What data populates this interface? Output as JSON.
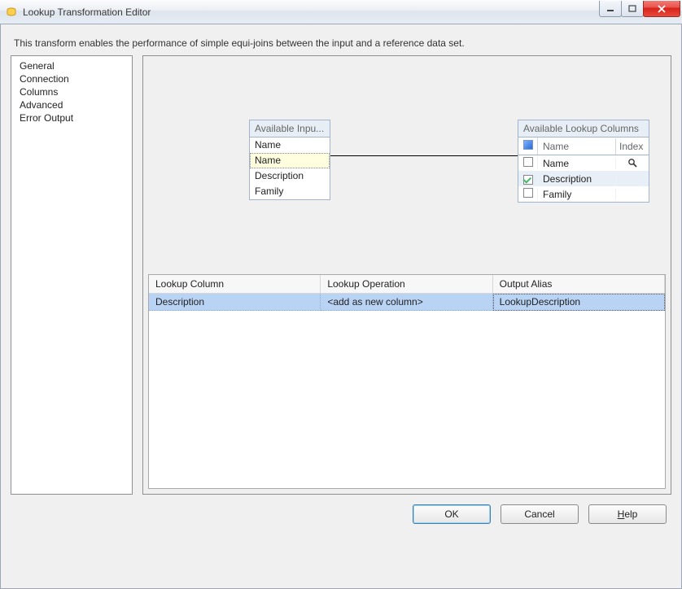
{
  "window": {
    "title": "Lookup Transformation Editor"
  },
  "description": "This transform enables the performance of simple equi-joins between the input and a reference data set.",
  "nav": {
    "items": [
      "General",
      "Connection",
      "Columns",
      "Advanced",
      "Error Output"
    ],
    "selected": "Columns"
  },
  "inputColumns": {
    "title": "Available Inpu...",
    "items": [
      "Name",
      "Name",
      "Description",
      "Family"
    ],
    "selectedIndex": 1
  },
  "lookupColumns": {
    "title": "Available Lookup Columns",
    "colNameHeader": "Name",
    "colIndexHeader": "Index",
    "items": [
      {
        "name": "Name",
        "checked": false,
        "hasIndexIcon": true
      },
      {
        "name": "Description",
        "checked": true,
        "hasIndexIcon": false
      },
      {
        "name": "Family",
        "checked": false,
        "hasIndexIcon": false
      }
    ],
    "selectedIndex": 1
  },
  "grid": {
    "headers": {
      "lookupColumn": "Lookup Column",
      "lookupOperation": "Lookup Operation",
      "outputAlias": "Output Alias"
    },
    "row": {
      "lookupColumn": "Description",
      "lookupOperation": "<add as new column>",
      "outputAlias": "LookupDescription"
    }
  },
  "buttons": {
    "ok": "OK",
    "cancel": "Cancel",
    "help": "Help"
  }
}
